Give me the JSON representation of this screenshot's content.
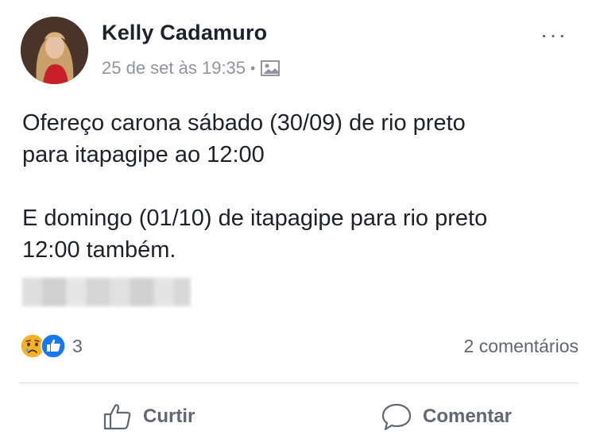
{
  "post": {
    "author": "Kelly Cadamuro",
    "timestamp": "25 de set às 19:35",
    "separator": "•",
    "audience_icon": "photo-album-icon",
    "more_label": "···",
    "text_lines_1": [
      "Ofereço carona sábado (30/09) de rio preto",
      "para itapagipe ao 12:00"
    ],
    "text_lines_2": [
      "E domingo (01/10) de itapagipe para rio preto",
      "12:00 também."
    ],
    "redacted_line": "blurred-contact-info"
  },
  "reactions": {
    "icons": [
      "sad-reaction-icon",
      "like-reaction-icon"
    ],
    "count": "3",
    "comments": "2 comentários"
  },
  "actions": {
    "like_label": "Curtir",
    "comment_label": "Comentar"
  },
  "colors": {
    "text": "#1d2129",
    "secondary": "#606770",
    "meta": "#90949c",
    "like_blue": "#1877f2",
    "sad_yellow": "#f7b125"
  }
}
